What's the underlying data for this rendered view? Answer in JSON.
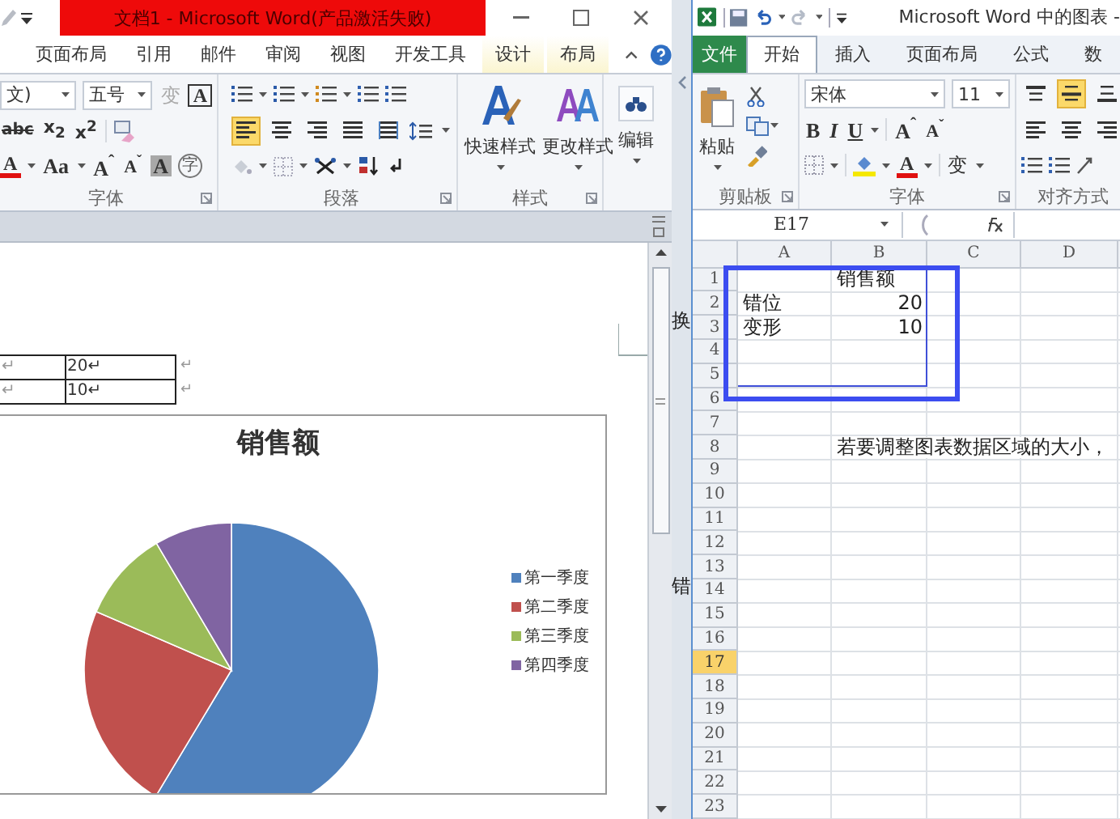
{
  "word": {
    "title": "文档1 - Microsoft Word(产品激活失败)",
    "tabs": [
      {
        "label": "页面布局",
        "selected": false,
        "contextual": false
      },
      {
        "label": "引用",
        "selected": false,
        "contextual": false
      },
      {
        "label": "邮件",
        "selected": false,
        "contextual": false
      },
      {
        "label": "审阅",
        "selected": false,
        "contextual": false
      },
      {
        "label": "视图",
        "selected": false,
        "contextual": false
      },
      {
        "label": "开发工具",
        "selected": false,
        "contextual": false
      },
      {
        "label": "设计",
        "selected": false,
        "contextual": true
      },
      {
        "label": "布局",
        "selected": false,
        "contextual": true
      }
    ],
    "font": {
      "label": "字体",
      "font_name": "文)",
      "font_size": "五号",
      "phonetic": "变",
      "border_char": "A",
      "strikethrough": "abc",
      "subscript": "x$_{2}$",
      "superscript": "x$^{2}$",
      "font_color": "A",
      "change_case": "Aa",
      "grow": "A$^{ˆ}$",
      "shrink": "A$^{ˇ}$",
      "shading_char": "A",
      "enclose": "字"
    },
    "paragraph": {
      "label": "段落",
      "alignment": [
        {
          "kind": "left",
          "selected": true
        },
        {
          "kind": "center",
          "selected": false
        },
        {
          "kind": "right",
          "selected": false
        },
        {
          "kind": "justify",
          "selected": false
        },
        {
          "kind": "distributed",
          "selected": false
        }
      ]
    },
    "styles": {
      "label": "样式",
      "quick": "快速样式",
      "change": "更改样式"
    },
    "editing": {
      "label": "编辑"
    },
    "table_rows": [
      {
        "col_1": "↵",
        "col_2": "20↵",
        "end": "↵"
      },
      {
        "col_1": "↵",
        "col_2": "10↵",
        "end": "↵"
      }
    ],
    "chart": {
      "title": "销售额",
      "legend": [
        {
          "label": "第一季度",
          "color": "#4f81bd"
        },
        {
          "label": "第二季度",
          "color": "#c0504d"
        },
        {
          "label": "第三季度",
          "color": "#9bbb59"
        },
        {
          "label": "第四季度",
          "color": "#8064a2"
        }
      ]
    }
  },
  "behind_window_text": [
    "换",
    "错"
  ],
  "excel": {
    "title": "Microsoft Word 中的图表 -",
    "tabs": [
      {
        "label": "文件",
        "kind": "file",
        "selected": false
      },
      {
        "label": "开始",
        "kind": "tab",
        "selected": true
      },
      {
        "label": "插入",
        "kind": "tab",
        "selected": false
      },
      {
        "label": "页面布局",
        "kind": "tab",
        "selected": false
      },
      {
        "label": "公式",
        "kind": "tab",
        "selected": false
      },
      {
        "label": "数",
        "kind": "tab",
        "selected": false
      }
    ],
    "clipboard": {
      "paste": "粘贴",
      "label": "剪贴板"
    },
    "font": {
      "label": "字体",
      "font_name": "宋体",
      "font_size": "11",
      "bold": "B",
      "italic": "I",
      "underline": "U",
      "grow": "A$^{ˆ}$",
      "shrink": "A$^{ˇ}$",
      "font_color": "A",
      "phonetic": "变"
    },
    "alignment": {
      "label": "对齐方式",
      "vertical": [
        {
          "kind": "top",
          "selected": false
        },
        {
          "kind": "middle",
          "selected": true
        },
        {
          "kind": "bottom",
          "selected": false
        }
      ],
      "horizontal": [
        {
          "kind": "left",
          "selected": false
        },
        {
          "kind": "center",
          "selected": false
        },
        {
          "kind": "right",
          "selected": false
        }
      ]
    },
    "name_box": "E17",
    "columns": [
      {
        "label": "A",
        "selected": false
      },
      {
        "label": "B",
        "selected": false
      },
      {
        "label": "C",
        "selected": false
      },
      {
        "label": "D",
        "selected": false
      }
    ],
    "rows": [
      {
        "number": "1",
        "selected": false,
        "cells": [
          null,
          {
            "text": "销售额",
            "kind": "text"
          }
        ]
      },
      {
        "number": "2",
        "selected": false,
        "cells": [
          {
            "text": "错位",
            "kind": "text"
          },
          {
            "text": "20",
            "kind": "number"
          }
        ]
      },
      {
        "number": "3",
        "selected": false,
        "cells": [
          {
            "text": "变形",
            "kind": "text"
          },
          {
            "text": "10",
            "kind": "number"
          }
        ]
      },
      {
        "number": "4",
        "selected": false
      },
      {
        "number": "5",
        "selected": false
      },
      {
        "number": "6",
        "selected": false
      },
      {
        "number": "7",
        "selected": false
      },
      {
        "number": "8",
        "selected": false,
        "cells": [
          null,
          {
            "text": "若要调整图表数据区域的大小，",
            "kind": "text"
          }
        ]
      },
      {
        "number": "9",
        "selected": false
      },
      {
        "number": "10",
        "selected": false
      },
      {
        "number": "11",
        "selected": false
      },
      {
        "number": "12",
        "selected": false
      },
      {
        "number": "13",
        "selected": false
      },
      {
        "number": "14",
        "selected": false
      },
      {
        "number": "15",
        "selected": false
      },
      {
        "number": "16",
        "selected": false
      },
      {
        "number": "17",
        "selected": true
      },
      {
        "number": "18",
        "selected": false
      },
      {
        "number": "19",
        "selected": false
      },
      {
        "number": "20",
        "selected": false
      },
      {
        "number": "21",
        "selected": false
      },
      {
        "number": "22",
        "selected": false
      },
      {
        "number": "23",
        "selected": false
      }
    ]
  }
}
